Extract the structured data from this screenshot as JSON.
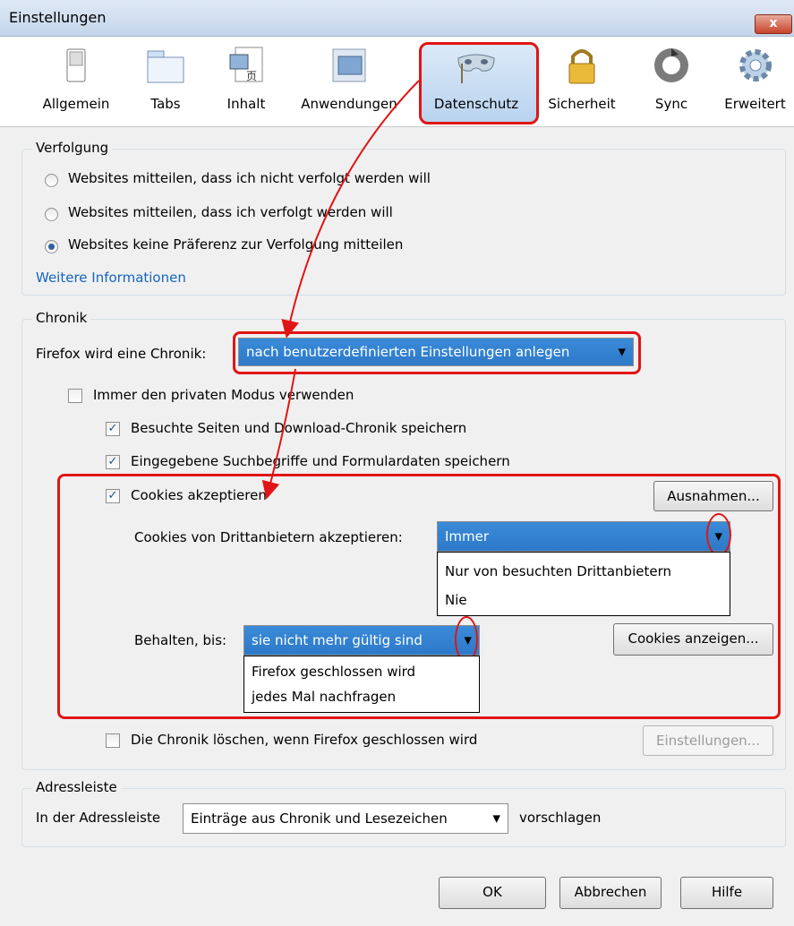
{
  "window": {
    "title": "Einstellungen",
    "close": "x"
  },
  "toolbar": {
    "items": [
      {
        "label": "Allgemein",
        "icon": "switch-icon"
      },
      {
        "label": "Tabs",
        "icon": "tabs-icon"
      },
      {
        "label": "Inhalt",
        "icon": "content-icon"
      },
      {
        "label": "Anwendungen",
        "icon": "applications-icon"
      },
      {
        "label": "Datenschutz",
        "icon": "mask-icon",
        "selected": true
      },
      {
        "label": "Sicherheit",
        "icon": "lock-icon"
      },
      {
        "label": "Sync",
        "icon": "sync-icon"
      },
      {
        "label": "Erweitert",
        "icon": "gear-icon"
      }
    ]
  },
  "tracking": {
    "legend": "Verfolgung",
    "options": [
      "Websites mitteilen, dass ich nicht verfolgt werden will",
      "Websites mitteilen, dass ich verfolgt werden will",
      "Websites keine Präferenz zur Verfolgung mitteilen"
    ],
    "selected_index": 2,
    "more_info": "Weitere Informationen"
  },
  "history": {
    "legend": "Chronik",
    "mode_label": "Firefox wird eine Chronik:",
    "mode_value": "nach benutzerdefinierten Einstellungen anlegen",
    "private_mode": "Immer den privaten Modus verwenden",
    "save_history": "Besuchte Seiten und Download-Chronik speichern",
    "save_forms": "Eingegebene Suchbegriffe und Formulardaten speichern",
    "accept_cookies": "Cookies akzeptieren",
    "exceptions_button": "Ausnahmen...",
    "third_party_label": "Cookies von Drittanbietern akzeptieren:",
    "third_party_value": "Immer",
    "third_party_options": [
      "Nur von besuchten Drittanbietern",
      "Nie"
    ],
    "keep_label": "Behalten, bis:",
    "keep_value": "sie nicht mehr gültig sind",
    "keep_options": [
      "Firefox geschlossen wird",
      "jedes Mal nachfragen"
    ],
    "show_cookies_button": "Cookies anzeigen...",
    "clear_on_close": "Die Chronik löschen, wenn Firefox geschlossen wird",
    "settings_button": "Einstellungen..."
  },
  "addressbar": {
    "legend": "Adressleiste",
    "label": "In der Adressleiste",
    "value": "Einträge aus Chronik und Lesezeichen",
    "suffix": "vorschlagen"
  },
  "footer": {
    "ok": "OK",
    "cancel": "Abbrechen",
    "help": "Hilfe"
  },
  "colors": {
    "highlight": "#e01515",
    "selection": "#3a8bd8",
    "link": "#1565c0"
  }
}
